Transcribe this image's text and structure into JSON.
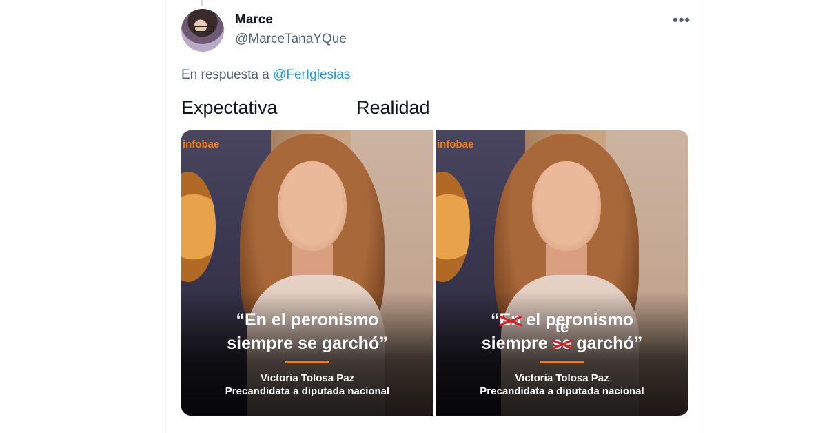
{
  "tweet": {
    "name": "Marce",
    "handle": "@MarceTanaYQue",
    "reply_prefix": "En respuesta a",
    "reply_to": "@FerIglesias",
    "more_icon": "ellipsis-icon"
  },
  "labels": {
    "left": "Expectativa",
    "right": "Realidad"
  },
  "image": {
    "brand": "infobae",
    "left_quote_line1": "“En el peronismo",
    "left_quote_line2": "siempre se garchó”",
    "right_quote_open": "“",
    "right_struck_word1": "En",
    "right_quote_rest1": " el peronismo",
    "right_quote_line2_a": "siempre ",
    "right_struck_word2": "se",
    "right_inserted_word": "te",
    "right_quote_line2_b": " garchó”",
    "caption_name": "Victoria Tolosa Paz",
    "caption_role": "Precandidata a diputada nacional"
  },
  "colors": {
    "brand_orange": "#ff7a00",
    "link_blue": "#1d9bf0",
    "strike_red": "#e01b24"
  }
}
